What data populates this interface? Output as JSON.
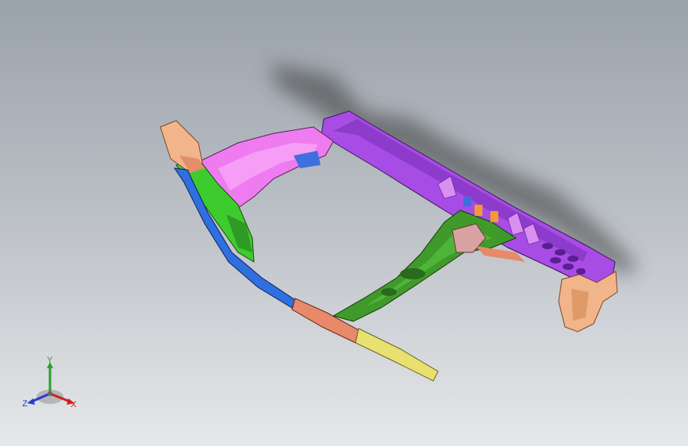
{
  "viewport": {
    "background_top": "#9aa2aa",
    "background_bottom": "#e6e8ea"
  },
  "model": {
    "description_icon": "vehicle-frame-3d-model",
    "part_colors": {
      "roof_rail": "#a84ce6",
      "roof_rail_dark": "#7c30b8",
      "header_front": "#ee7cf0",
      "a_pillar": "#3ecb2e",
      "b_pillar": "#3f9a2a",
      "sill_blue": "#2f6fe0",
      "sill_salmon": "#e88a6a",
      "sill_yellow": "#e8e070",
      "bracket_tan": "#f2b48a",
      "bracket_orange": "#f39a30",
      "inner_panel_pink": "#d9a2a2"
    }
  },
  "triad": {
    "y_label": "Y",
    "z_label": "Z",
    "x_label": "X",
    "y_color": "#2e9e2e",
    "z_color": "#2b3cc8",
    "x_color": "#d02020"
  }
}
